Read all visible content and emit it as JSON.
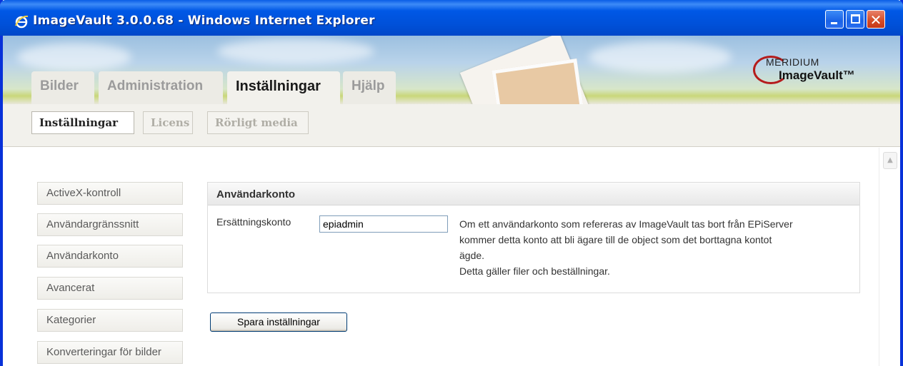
{
  "window": {
    "title": "ImageVault 3.0.0.68 - Windows Internet Explorer",
    "controls": {
      "minimize_icon": "minimize-icon",
      "maximize_icon": "maximize-icon",
      "close_icon": "close-icon"
    }
  },
  "logo": {
    "line1": "MERIDIUM",
    "line2": "ImageVault™"
  },
  "main_tabs": [
    {
      "label": "Bilder",
      "active": false
    },
    {
      "label": "Administration",
      "active": false
    },
    {
      "label": "Inställningar",
      "active": true
    },
    {
      "label": "Hjälp",
      "active": false
    }
  ],
  "sub_tabs": [
    {
      "label": "Inställningar",
      "active": true
    },
    {
      "label": "Licens",
      "active": false
    },
    {
      "label": "Rörligt media",
      "active": false
    }
  ],
  "sidebar": {
    "items": [
      {
        "label": "ActiveX-kontroll"
      },
      {
        "label": "Användargränssnitt"
      },
      {
        "label": "Användarkonto"
      },
      {
        "label": "Avancerat"
      },
      {
        "label": "Kategorier"
      },
      {
        "label": "Konverteringar för bilder"
      }
    ]
  },
  "panel": {
    "title": "Användarkonto",
    "field_label": "Ersättningskonto",
    "field_value": "epiadmin",
    "help_lines": [
      "Om ett användarkonto som refereras av ImageVault tas bort från EPiServer",
      "kommer detta konto att bli ägare till de object som det borttagna kontot",
      "ägde.",
      "Detta gäller filer och beställningar."
    ]
  },
  "save_label": "Spara inställningar",
  "colors": {
    "titlebar": "#0054e3",
    "close_button": "#d44a25",
    "accent_red": "#b51c1c"
  }
}
